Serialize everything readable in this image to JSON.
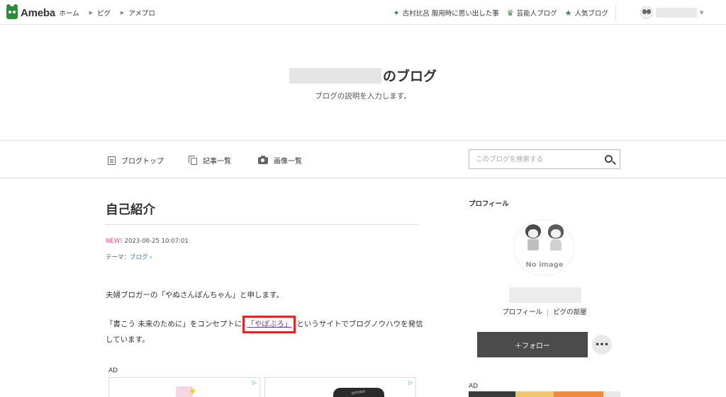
{
  "header": {
    "logo_text": "Ameba",
    "breadcrumbs": [
      "ホーム",
      "ピグ",
      "アメブロ"
    ],
    "links": [
      {
        "label": "古村比呂 服用時に思い出した事",
        "icon": "sparkle-icon"
      },
      {
        "label": "芸能人ブログ",
        "icon": "crown-icon"
      },
      {
        "label": "人気ブログ",
        "icon": "star-icon"
      }
    ]
  },
  "blog": {
    "title_suffix": "のブログ",
    "description": "ブログの説明を入力します。"
  },
  "nav": {
    "items": [
      "ブログトップ",
      "記事一覧",
      "画像一覧"
    ],
    "search_placeholder": "このブログを検索する"
  },
  "article": {
    "title": "自己紹介",
    "new_badge": "NEW!",
    "datetime": "2023-06-25 10:07:01",
    "theme_label": "テーマ：",
    "theme_link": "ブログ",
    "para1": "夫婦ブロガーの「やぬさんぽんちゃん」と申します。",
    "para2_before": "「書こう 未来のために」をコンセプトに",
    "para2_link": "「やぽぶろ」",
    "para2_after": "というサイトでブログノウハウを発信しています。",
    "ad_label": "AD",
    "ad2_brand": "omron"
  },
  "sidebar": {
    "heading": "プロフィール",
    "no_image": "No image",
    "link_profile": "プロフィール",
    "link_room": "ピグの部屋",
    "follow_label": "＋フォロー",
    "more_label": "•••",
    "ad_label": "AD"
  },
  "colors": {
    "brand": "#2d8c3c",
    "new_badge": "#e34a8e",
    "highlight_border": "#e0282b",
    "follow_bg": "#4b4b4b"
  }
}
